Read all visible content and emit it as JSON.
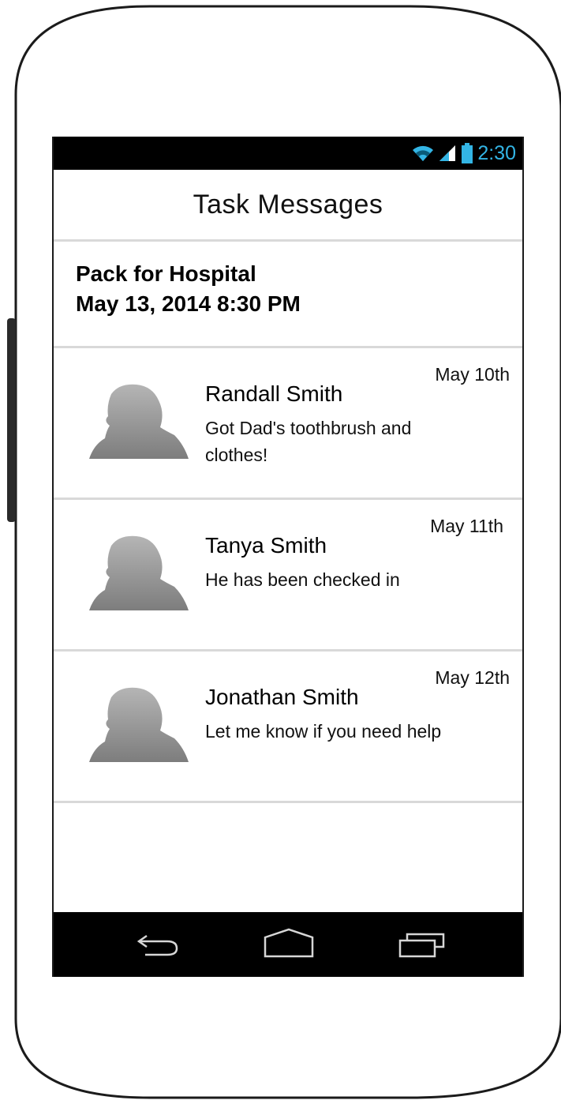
{
  "status_bar": {
    "time": "2:30",
    "icons": [
      "wifi-icon",
      "signal-icon",
      "battery-icon"
    ],
    "accent_color": "#33b5e5"
  },
  "header": {
    "title": "Task Messages"
  },
  "task": {
    "name": "Pack for Hospital",
    "datetime": "May 13, 2014 8:30 PM"
  },
  "messages": [
    {
      "name": "Randall Smith",
      "text": "Got Dad's toothbrush and clothes!",
      "date": "May 10th",
      "avatar_icon": "person-silhouette-icon"
    },
    {
      "name": "Tanya Smith",
      "text": "He has been checked in",
      "date": "May 11th",
      "avatar_icon": "person-silhouette-icon"
    },
    {
      "name": "Jonathan Smith",
      "text": "Let me know if you need help",
      "date": "May 12th",
      "avatar_icon": "person-silhouette-icon"
    }
  ],
  "nav_bar": {
    "buttons": [
      "back-icon",
      "home-icon",
      "recents-icon"
    ]
  }
}
